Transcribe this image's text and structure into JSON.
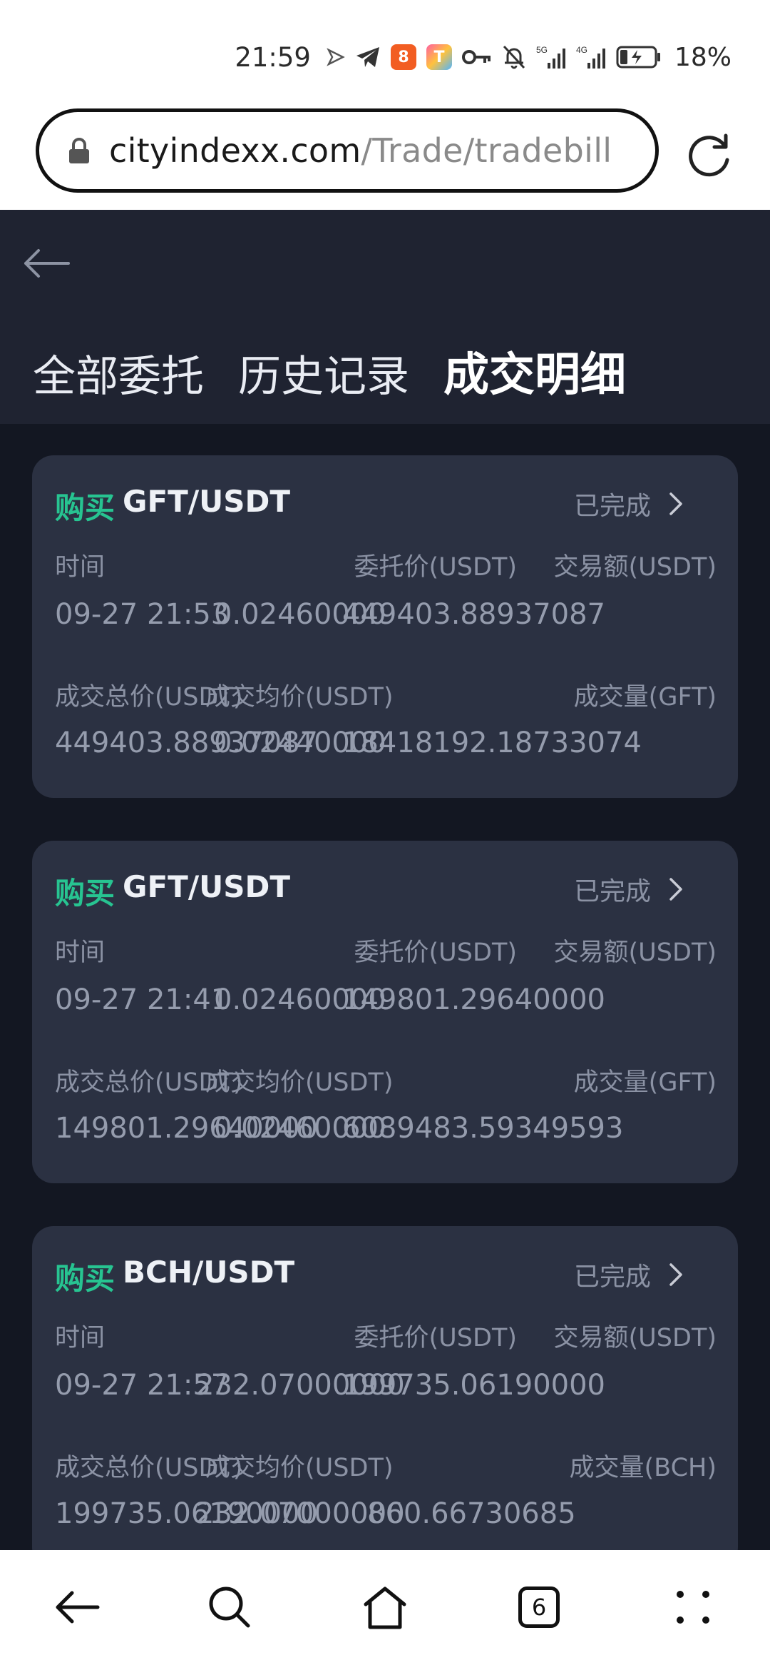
{
  "status_bar": {
    "time": "21:59",
    "battery_pct": "18%",
    "icons": [
      "navigation-arrow-icon",
      "telegram-icon",
      "app-badge-icon",
      "app-badge-icon",
      "key-icon",
      "mute-bell-icon",
      "signal-5g-icon",
      "signal-4g-icon",
      "battery-icon"
    ]
  },
  "address_bar": {
    "domain": "cityindexx.com",
    "path": "/Trade/tradebill"
  },
  "header": {
    "tabs": [
      {
        "label": "全部委托",
        "active": false
      },
      {
        "label": "历史记录",
        "active": false
      },
      {
        "label": "成交明细",
        "active": true
      }
    ]
  },
  "orders": [
    {
      "side": "购买",
      "pair": "GFT/USDT",
      "status": "已完成",
      "time_label": "时间",
      "time": "09-27 21:53",
      "order_price_label": "委托价(USDT)",
      "order_price": "0.02460000",
      "amount_label": "交易额(USDT)",
      "amount": "449403.88937087",
      "total_label": "成交总价(USDT)",
      "total": "449403.88937087",
      "avg_label": "成交均价(USDT)",
      "avg": "0.02440000",
      "volume_label": "成交量(GFT)",
      "volume": "18418192.18733074"
    },
    {
      "side": "购买",
      "pair": "GFT/USDT",
      "status": "已完成",
      "time_label": "时间",
      "time": "09-27 21:41",
      "order_price_label": "委托价(USDT)",
      "order_price": "0.02460000",
      "amount_label": "交易额(USDT)",
      "amount": "149801.29640000",
      "total_label": "成交总价(USDT)",
      "total": "149801.29640000",
      "avg_label": "成交均价(USDT)",
      "avg": "0.02460000",
      "volume_label": "成交量(GFT)",
      "volume": "6089483.59349593"
    },
    {
      "side": "购买",
      "pair": "BCH/USDT",
      "status": "已完成",
      "time_label": "时间",
      "time": "09-27 21:57",
      "order_price_label": "委托价(USDT)",
      "order_price": "232.07000000",
      "amount_label": "交易额(USDT)",
      "amount": "199735.06190000",
      "total_label": "成交总价(USDT)",
      "total": "199735.06190000",
      "avg_label": "成交均价(USDT)",
      "avg": "232.07000000",
      "volume_label": "成交量(BCH)",
      "volume": "860.66730685"
    }
  ],
  "bottom_nav": {
    "tab_count": "6",
    "icons": [
      "back-icon",
      "search-icon",
      "home-icon",
      "tabs-icon",
      "menu-icon"
    ]
  },
  "colors": {
    "header_bg": "#1f2331",
    "content_bg": "#131722",
    "card_bg": "#2b3142",
    "buy_green": "#27c491",
    "muted_text": "#8b92a4"
  }
}
